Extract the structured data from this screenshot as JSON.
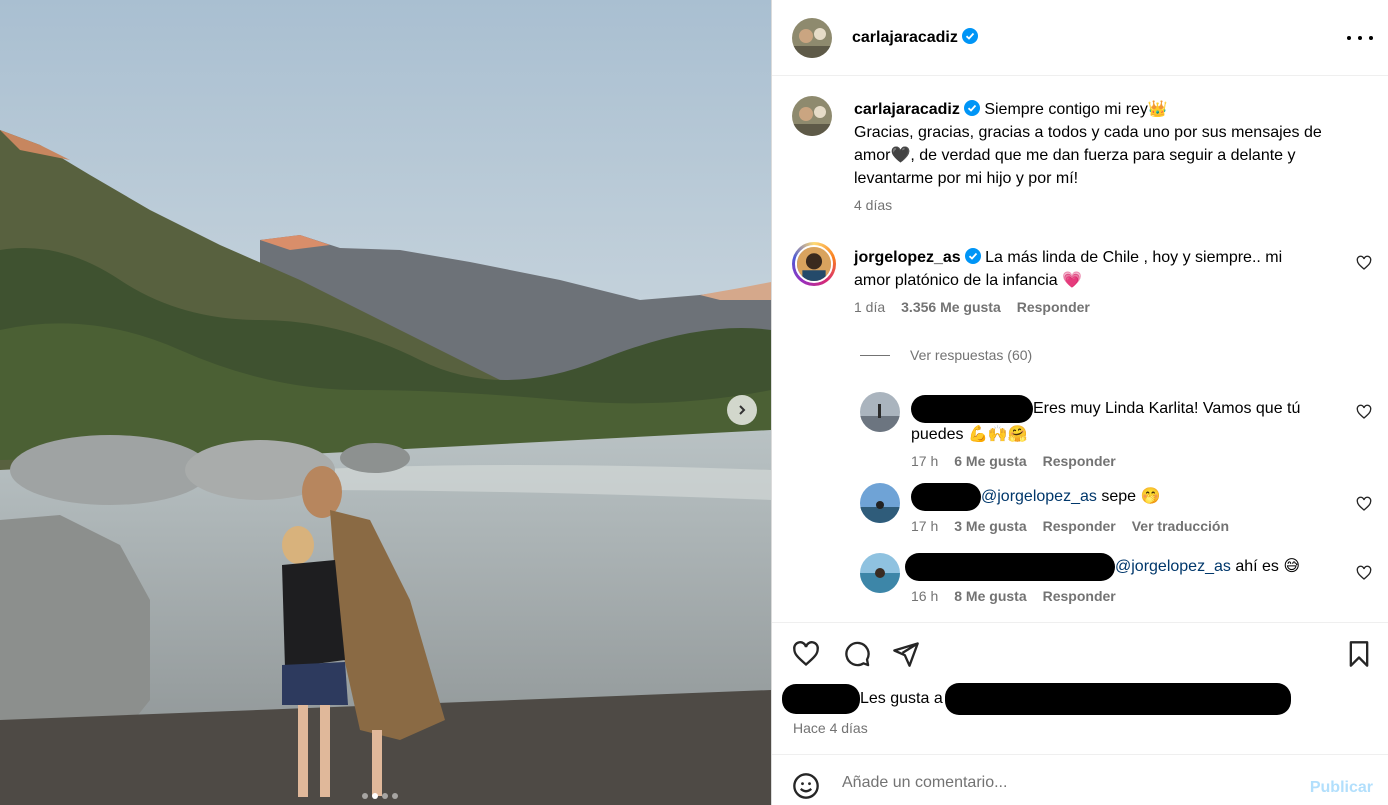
{
  "post": {
    "author": "carlajaracadiz",
    "verified": true,
    "caption_lines": [
      "Siempre contigo mi rey👑",
      "Gracias, gracias, gracias a todos y cada uno por sus mensajes de",
      "amor🖤, de verdad que me dan fuerza para seguir a delante y",
      "levantarme por mi hijo y por mí!"
    ],
    "caption_time": "4 días"
  },
  "comments": [
    {
      "username": "jorgelopez_as",
      "verified": true,
      "lines": [
        "La más linda de Chile , hoy y siempre.. mi",
        "amor platónico de la infancia 💗"
      ],
      "time": "1 día",
      "likes": "3.356 Me gusta",
      "reply": "Responder"
    }
  ],
  "replies_toggle": "Ver respuestas (60)",
  "replies": [
    {
      "lines": [
        "Eres muy Linda Karlita! Vamos que tú",
        "puedes 💪🙌🤗"
      ],
      "time": "17 h",
      "likes": "6 Me gusta",
      "reply": "Responder"
    },
    {
      "mention": "@jorgelopez_as",
      "text": " sepe 🤭",
      "time": "17 h",
      "likes": "3 Me gusta",
      "reply": "Responder",
      "translate": "Ver traducción"
    },
    {
      "mention": "@jorgelopez_as",
      "text": " ahí es 😅",
      "time": "16 h",
      "likes": "8 Me gusta",
      "reply": "Responder"
    }
  ],
  "likes_text": "Les gusta a",
  "likes_time": "Hace 4 días",
  "composer": {
    "placeholder": "Añade un comentario...",
    "publish": "Publicar"
  },
  "colors": {
    "verified": "#0095f6",
    "heart": "#ff3040",
    "mention": "#00376b",
    "publish_disabled": "#b2dffc",
    "muted": "#737373"
  },
  "carousel": {
    "slides": 4,
    "active": 1
  }
}
